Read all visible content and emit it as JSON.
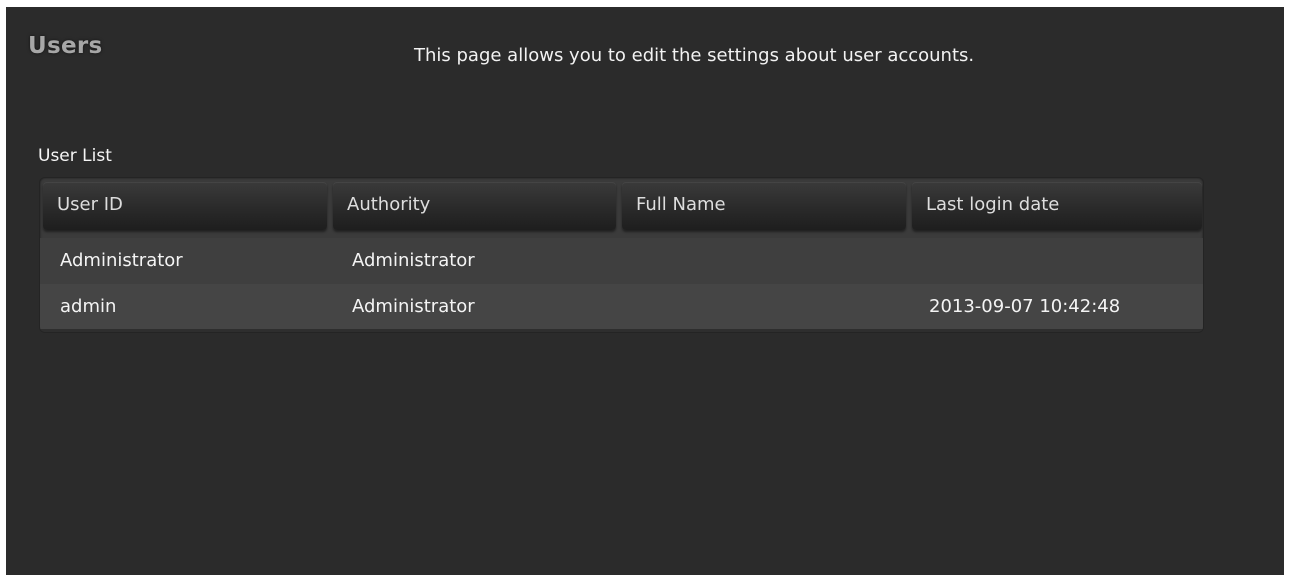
{
  "page": {
    "title": "Users",
    "description": "This page allows you to edit the settings about user accounts."
  },
  "user_list": {
    "label": "User List",
    "columns": [
      "User ID",
      "Authority",
      "Full Name",
      "Last login date"
    ],
    "rows": [
      {
        "user_id": "Administrator",
        "authority": "Administrator",
        "full_name": "",
        "last_login": ""
      },
      {
        "user_id": "admin",
        "authority": "Administrator",
        "full_name": "",
        "last_login": "2013-09-07 10:42:48"
      }
    ]
  },
  "colors": {
    "panel_background": "#2b2b2b",
    "title_text": "#a7a7a7",
    "body_text": "#f2f2f2"
  }
}
